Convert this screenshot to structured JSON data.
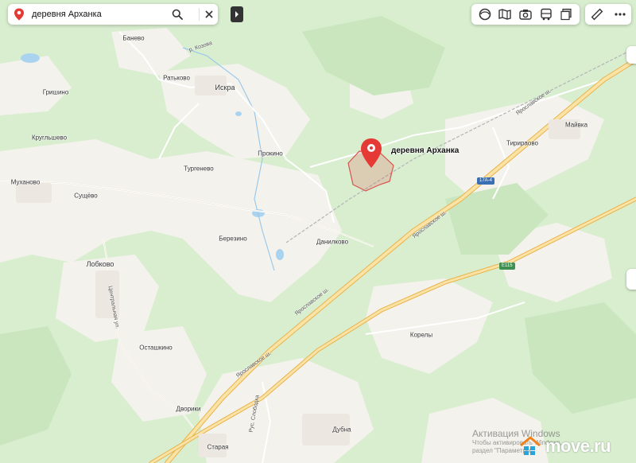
{
  "search": {
    "query": "деревня Арханка"
  },
  "selected_place": {
    "name": "деревня Арханка"
  },
  "toolbar": {
    "layer_icons": [
      "panorama-icon",
      "map-book-icon",
      "photo-camera-icon",
      "bus-icon",
      "layers-icon"
    ],
    "tool_icons": [
      "ruler-icon",
      "more-menu-icon"
    ]
  },
  "settlements": [
    "Баневo",
    "Ратьково",
    "Искра",
    "Гришино",
    "Кругльшево",
    "Прокино",
    "Тургенево",
    "Муханово",
    "Сущёво",
    "Березино",
    "Данилково",
    "Лобково",
    "Тирираово",
    "Майвка",
    "Корелы",
    "Осташкино",
    "Дворики",
    "Дубна",
    "Старая"
  ],
  "road_labels": [
    "р. Козова",
    "Ярославское ш.",
    "Ярославское ш.",
    "Ярославское ш.",
    "Ярославское ш.",
    "Центральная ул.",
    "Рус. Слободка"
  ],
  "road_shields": [
    "17А-4",
    "E115"
  ],
  "overlay": {
    "activation_line1": "Активация Windows",
    "activation_line2": "Чтобы активировать Windows,",
    "activation_line3": "раздел \"Параметры\"",
    "watermark": "move.ru"
  },
  "colors": {
    "forest": "#d6edcf",
    "field": "#f4f3ee",
    "highway": "#f6c562",
    "marker": "#e53935",
    "water": "#aad3f0"
  }
}
